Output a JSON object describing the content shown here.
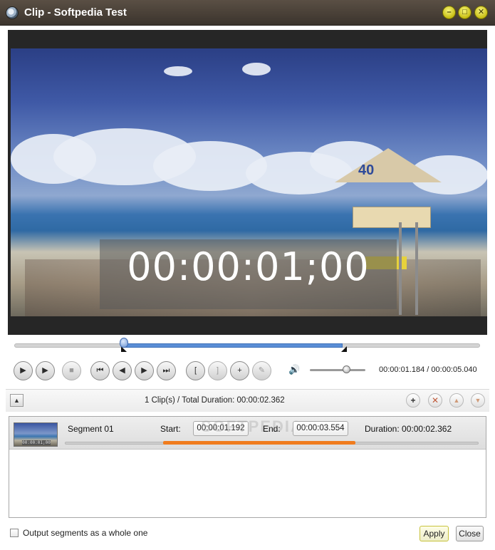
{
  "window": {
    "title": "Clip - Softpedia Test",
    "icons": {
      "app": "film-reel-icon",
      "minimize": "minimize-icon",
      "maximize": "maximize-icon",
      "close": "close-icon"
    }
  },
  "player": {
    "timecode_overlay": "00:00:01;00",
    "tower_sign": "40",
    "current_time": "00:00:01.184",
    "total_time": "00:00:05.040",
    "time_separator": " / ",
    "timeline_selection": {
      "start": 1.192,
      "end": 3.554,
      "playhead": 1.184,
      "total": 5.04
    },
    "volume_level": 0.65
  },
  "controls": [
    {
      "name": "play-button",
      "icon": "play-icon",
      "glyph": "▶",
      "enabled": true
    },
    {
      "name": "play-segment-button",
      "icon": "play-segment-icon",
      "glyph": "▶",
      "enabled": true
    },
    {
      "name": "stop-button",
      "icon": "stop-icon",
      "glyph": "■",
      "enabled": false
    },
    {
      "name": "go-to-start-button",
      "icon": "skip-start-icon",
      "glyph": "⏮",
      "enabled": true
    },
    {
      "name": "previous-frame-button",
      "icon": "step-back-icon",
      "glyph": "◀",
      "enabled": true
    },
    {
      "name": "next-frame-button",
      "icon": "step-forward-icon",
      "glyph": "▶",
      "enabled": true
    },
    {
      "name": "go-to-end-button",
      "icon": "skip-end-icon",
      "glyph": "⏭",
      "enabled": true
    },
    {
      "name": "set-start-button",
      "icon": "mark-in-icon",
      "glyph": "[",
      "enabled": true
    },
    {
      "name": "set-end-button",
      "icon": "mark-out-icon",
      "glyph": "]",
      "enabled": false
    },
    {
      "name": "new-segment-button",
      "icon": "add-document-icon",
      "glyph": "+",
      "enabled": true
    },
    {
      "name": "edit-button",
      "icon": "pencil-icon",
      "glyph": "✎",
      "enabled": false
    }
  ],
  "volume_icon": "speaker-icon",
  "list": {
    "summary": "1 Clip(s) /  Total Duration: 00:00:02.362",
    "collapse_icon": "triangle-up-icon",
    "actions": {
      "add": "add-icon",
      "delete": "delete-icon",
      "up": "move-up-icon",
      "down": "move-down-icon"
    }
  },
  "segments": [
    {
      "name": "Segment 01",
      "thumb_time": "00:00:01;00",
      "start_label": "Start:",
      "start": "00:00:01.192",
      "end_label": "End:",
      "end": "00:00:03.554",
      "duration_label": "Duration:",
      "duration": "00:00:02.362"
    }
  ],
  "watermark": "SOFTPEDIA",
  "footer": {
    "checkbox_label": "Output segments as a whole one",
    "checked": false,
    "apply_label": "Apply",
    "close_label": "Close"
  },
  "colors": {
    "titlebar": "#4a4139",
    "selection": "#5b8ed6",
    "segment_fill": "#f07c1e",
    "apply_border": "#c7c23b"
  }
}
